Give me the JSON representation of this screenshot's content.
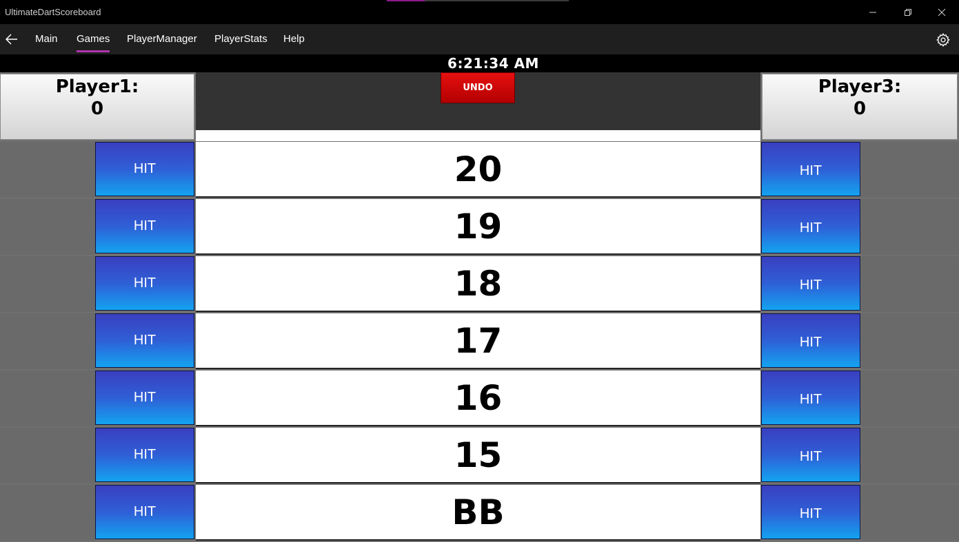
{
  "window": {
    "title": "UltimateDartScoreboard"
  },
  "nav": {
    "items": [
      {
        "label": "Main"
      },
      {
        "label": "Games"
      },
      {
        "label": "PlayerManager"
      },
      {
        "label": "PlayerStats"
      },
      {
        "label": "Help"
      }
    ],
    "selected": "Games"
  },
  "clock": "6:21:34 AM",
  "players": {
    "left": {
      "name": "Player1:",
      "score": "0"
    },
    "right": {
      "name": "Player3:",
      "score": "0"
    }
  },
  "undo_label": "UNDO",
  "hit_label": "HIT",
  "rows": [
    {
      "number": "20"
    },
    {
      "number": "19"
    },
    {
      "number": "18"
    },
    {
      "number": "17"
    },
    {
      "number": "16"
    },
    {
      "number": "15"
    },
    {
      "number": "BB"
    }
  ],
  "colors": {
    "accent": "#b034b0",
    "undo": "#d40000",
    "hit_top": "#3a3fbf",
    "hit_bottom": "#13a3f0"
  },
  "icons": {
    "back": "back-arrow-icon",
    "settings": "gear-icon",
    "minimize": "minimize-icon",
    "restore": "restore-icon",
    "close": "close-icon"
  }
}
